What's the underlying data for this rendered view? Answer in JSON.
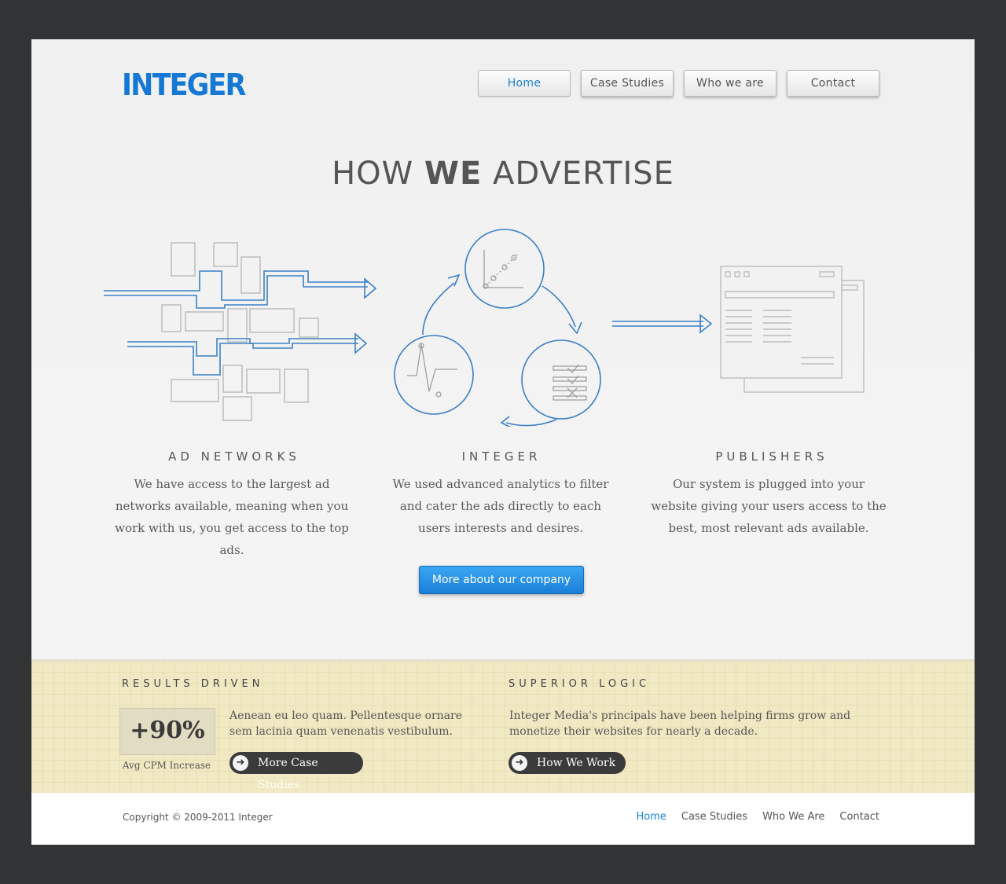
{
  "logo": "INTEGER",
  "nav": [
    {
      "label": "Home",
      "active": true
    },
    {
      "label": "Case Studies",
      "active": false
    },
    {
      "label": "Who we are",
      "active": false
    },
    {
      "label": "Contact",
      "active": false
    }
  ],
  "hero": {
    "title_pre": "HOW ",
    "title_bold": "WE",
    "title_post": " ADVERTISE"
  },
  "columns": [
    {
      "title": "AD NETWORKS",
      "text": "We have access to the largest ad networks available, meaning when you work with us, you get access to the top ads."
    },
    {
      "title": "INTEGER",
      "text": "We used advanced analytics to filter and cater the ads directly to each users interests and desires."
    },
    {
      "title": "PUBLISHERS",
      "text": "Our system is plugged into your website giving your users access to the best, most relevant ads available."
    }
  ],
  "cta": "More about our company",
  "band": {
    "left": {
      "title": "RESULTS DRIVEN",
      "stat": "+90%",
      "stat_label": "Avg CPM Increase",
      "text": "Aenean eu leo quam. Pellentesque ornare sem lacinia quam venenatis vestibulum.",
      "button": "More Case Studies"
    },
    "right": {
      "title": "SUPERIOR LOGIC",
      "text": "Integer Media's principals have been helping firms grow and monetize their websites for nearly a decade.",
      "button": "How We Work"
    }
  },
  "footer": {
    "copyright": "Copyright © 2009-2011 Integer",
    "links": [
      "Home",
      "Case Studies",
      "Who We Are",
      "Contact"
    ]
  },
  "colors": {
    "accent": "#1478d4",
    "background": "#323335",
    "band": "#f1e9c3",
    "illustration_line": "#3b7fc8"
  },
  "icons": {
    "pill_icon": "arrow-right-icon"
  }
}
